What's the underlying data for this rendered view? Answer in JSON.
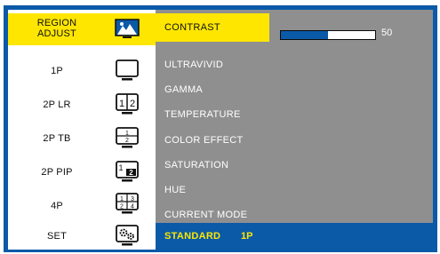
{
  "sidebar": {
    "items": [
      {
        "label_line1": "REGION",
        "label_line2": "ADJUST",
        "icon": "landscape-picture-icon",
        "active": true
      },
      {
        "label": "1P",
        "icon": "single-monitor-icon"
      },
      {
        "label": "2P LR",
        "icon": "split-left-right-icon"
      },
      {
        "label": "2P TB",
        "icon": "split-top-bottom-icon"
      },
      {
        "label": "2P PIP",
        "icon": "picture-in-picture-icon"
      },
      {
        "label": "4P",
        "icon": "quad-split-icon"
      },
      {
        "label": "SET",
        "icon": "gears-settings-icon"
      }
    ]
  },
  "menu": {
    "items": [
      {
        "label": "CONTRAST",
        "active": true
      },
      {
        "label": "ULTRAVIVID"
      },
      {
        "label": "GAMMA"
      },
      {
        "label": "TEMPERATURE"
      },
      {
        "label": "COLOR EFFECT"
      },
      {
        "label": "SATURATION"
      },
      {
        "label": "HUE"
      },
      {
        "label": "CURRENT MODE"
      }
    ]
  },
  "contrast": {
    "value": "50",
    "level_fraction": 0.5
  },
  "icon_text": {
    "lr_left": "1",
    "lr_right": "2",
    "tb_top": "1",
    "tb_bottom": "2",
    "pip_main": "1",
    "pip_inset": "2",
    "quad_1": "1",
    "quad_2": "3",
    "quad_3": "2",
    "quad_4": "4"
  },
  "status": {
    "mode": "STANDARD",
    "layout": "1P"
  },
  "colors": {
    "accent_yellow": "#ffe600",
    "frame_blue": "#0a5aa8",
    "menu_gray": "#8f8f8f"
  }
}
